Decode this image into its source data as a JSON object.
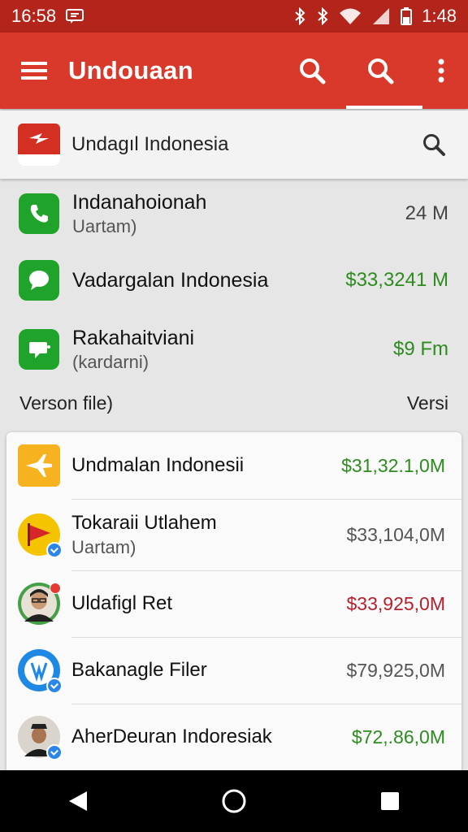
{
  "status_bar": {
    "time_left": "16:58",
    "time_right": "1:48"
  },
  "app_bar": {
    "title": "Undouaan"
  },
  "search": {
    "label": "Undagıl Indonesia"
  },
  "upper_list": [
    {
      "name": "Indanahoionah",
      "sub": "Uartam)",
      "value": "24 M",
      "value_color": "#444444",
      "icon": "phone-icon"
    },
    {
      "name": "Vadargalan Indonesia",
      "sub": "",
      "value": "$33,3241 M",
      "value_color": "#2e8b1f",
      "icon": "chat-bubble-icon"
    },
    {
      "name": "Rakahaitviani",
      "sub": "(kardarni)",
      "value": "$9 Fm",
      "value_color": "#2e8b1f",
      "icon": "message-icon"
    }
  ],
  "section": {
    "left": "Verson file)",
    "right": "Versi"
  },
  "card_list": [
    {
      "name": "Undmalan Indonesii",
      "sub": "",
      "value": "$31,32.1,0M",
      "value_color": "#2e8b1f",
      "icon": "plane-icon"
    },
    {
      "name": "Tokaraii Utlahem",
      "sub": "Uartam)",
      "value": "$33,104,0M",
      "value_color": "#555555",
      "icon": "flag-icon"
    },
    {
      "name": "Uldafigl Ret",
      "sub": "",
      "value": "$33,925,0M",
      "value_color": "#b3212e",
      "icon": "avatar-icon"
    },
    {
      "name": "Bakanagle Filer",
      "sub": "",
      "value": "$79,925,0M",
      "value_color": "#555555",
      "icon": "file-icon"
    },
    {
      "name": "AherDeuran Indoresiak",
      "sub": "",
      "value": "$72,.86,0M",
      "value_color": "#2e8b1f",
      "icon": "avatar-icon"
    }
  ]
}
